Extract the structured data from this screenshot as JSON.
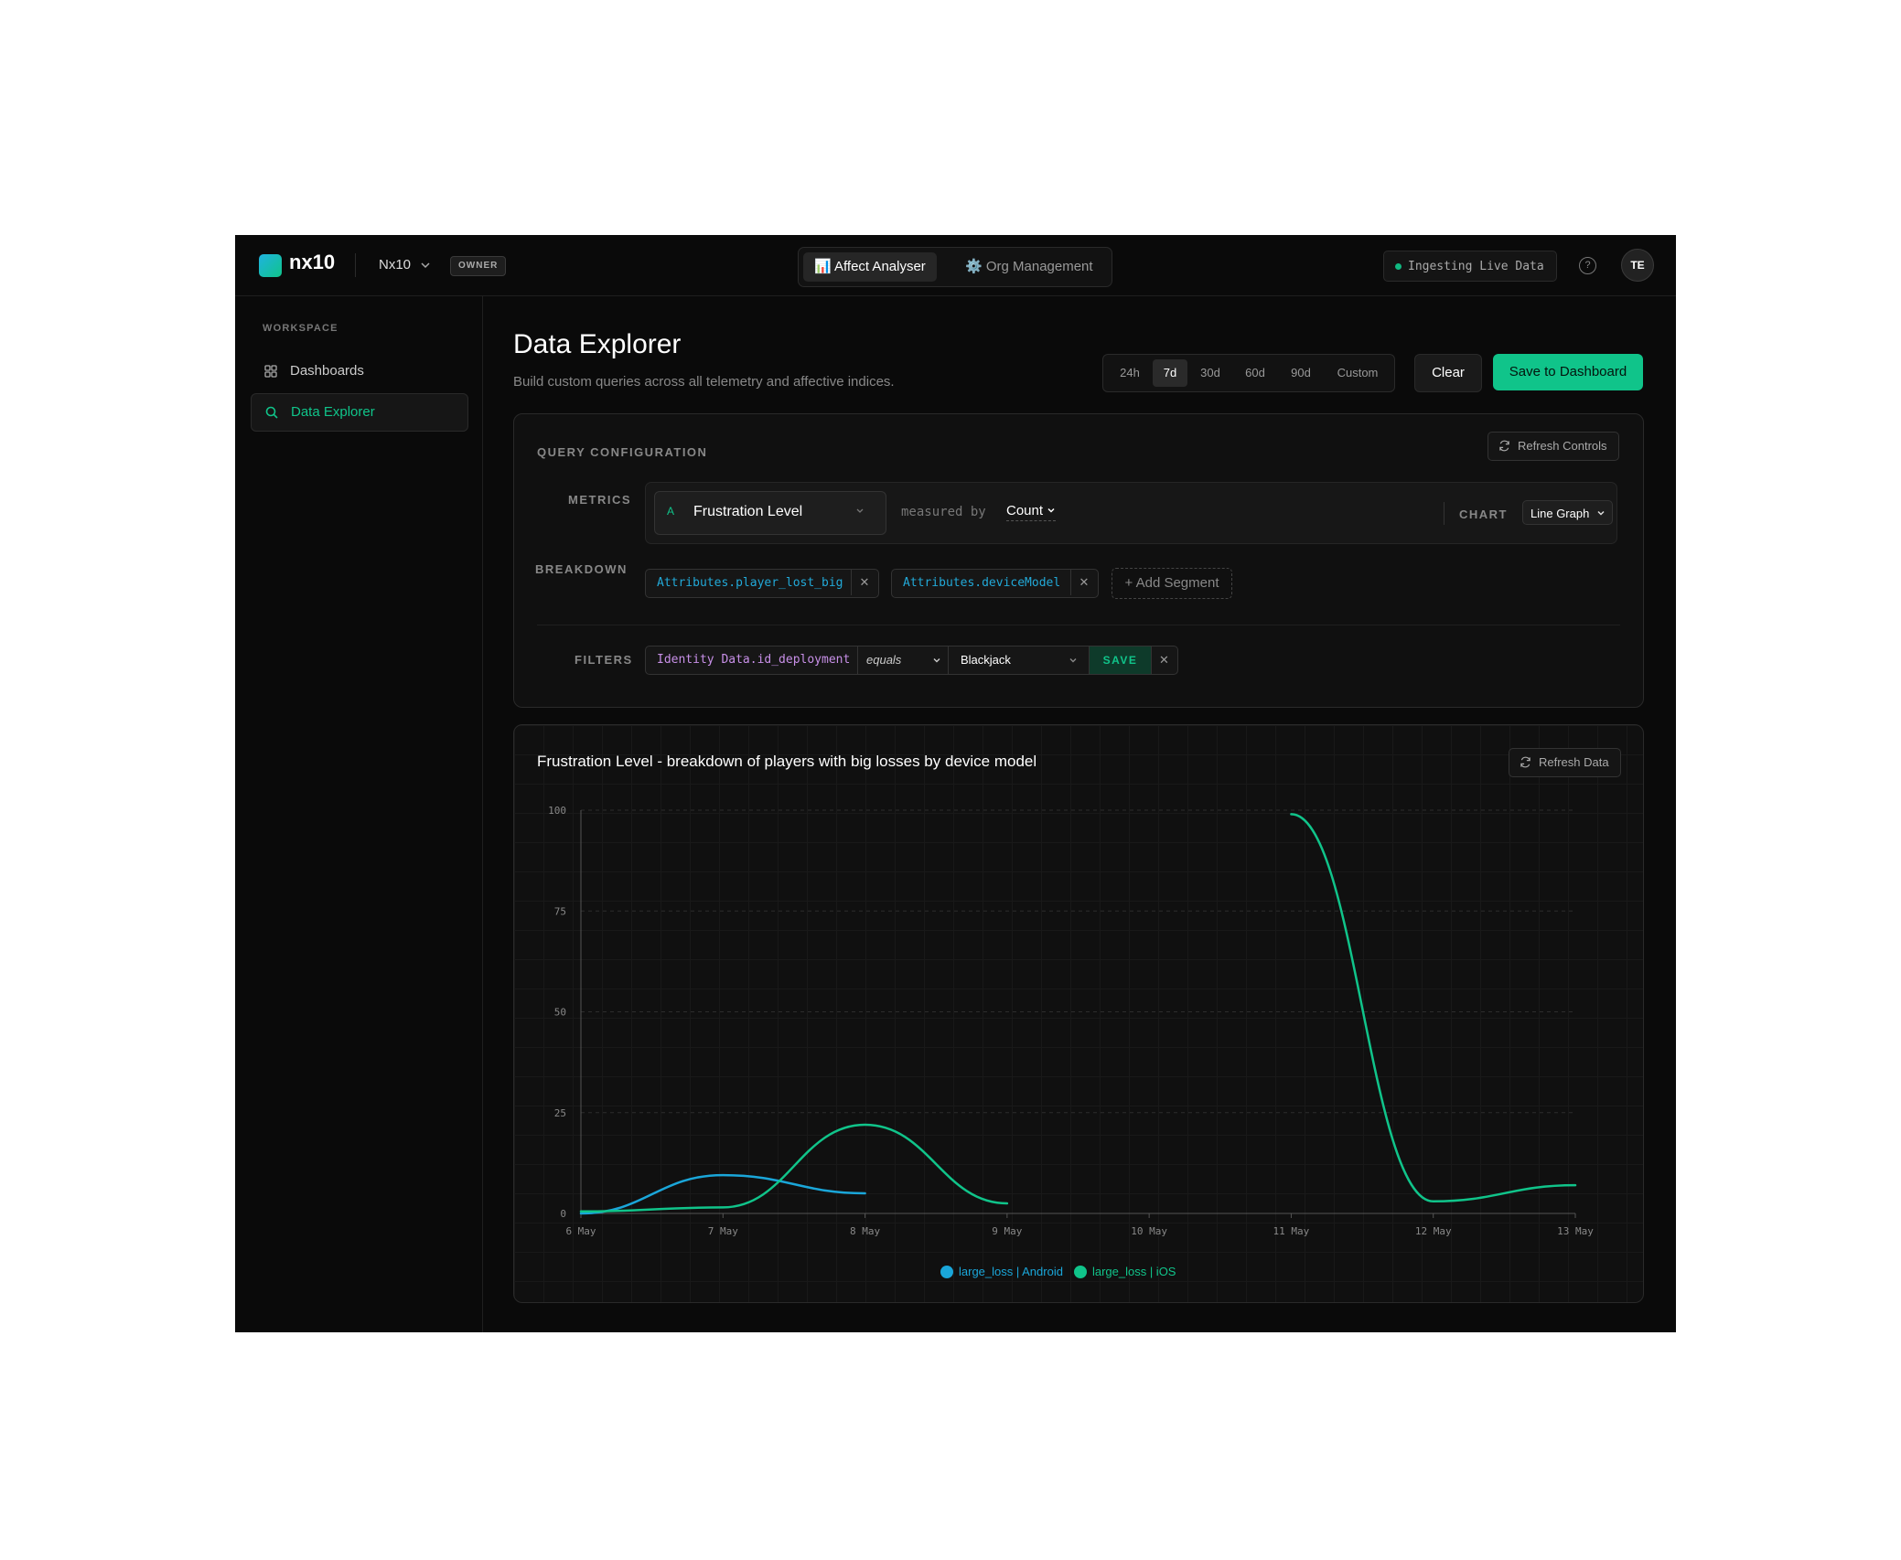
{
  "topbar": {
    "logo": "nx10",
    "org_name": "Nx10",
    "role_badge": "OWNER",
    "apps": [
      {
        "label": "📊 Affect Analyser",
        "active": true
      },
      {
        "label": "⚙️ Org Management",
        "active": false
      }
    ],
    "status": "Ingesting Live Data",
    "status_color": "#10b981",
    "help_icon": "help-circle-icon",
    "avatar": "TE"
  },
  "sidebar": {
    "section_label": "WORKSPACE",
    "items": [
      {
        "label": "Dashboards",
        "icon": "grid-icon",
        "active": false
      },
      {
        "label": "Data Explorer",
        "icon": "search-icon",
        "active": true
      }
    ]
  },
  "header": {
    "title": "Data Explorer",
    "subtitle": "Build custom queries across all telemetry and affective indices.",
    "ranges": [
      "24h",
      "7d",
      "30d",
      "60d",
      "90d",
      "Custom"
    ],
    "active_range": "7d",
    "clear_label": "Clear",
    "save_label": "Save to Dashboard"
  },
  "query": {
    "title": "QUERY CONFIGURATION",
    "refresh_label": "Refresh Controls",
    "metrics_label": "METRICS",
    "metric": {
      "letter": "A",
      "name": "Frustration Level"
    },
    "measured_by_label": "measured by",
    "measured_by": "Count",
    "chart_label": "CHART",
    "chart_type": "Line Graph",
    "breakdown_label": "BREAKDOWN",
    "breakdowns": [
      "Attributes.player_lost_big",
      "Attributes.deviceModel"
    ],
    "add_segment_label": "+ Add Segment",
    "filters_label": "FILTERS",
    "filter": {
      "field": "Identity Data.id_deployment",
      "operator": "equals",
      "value": "Blackjack",
      "save": "SAVE"
    }
  },
  "chart_panel": {
    "title": "Frustration Level - breakdown of players with big losses by device model",
    "refresh_label": "Refresh Data"
  },
  "chart_data": {
    "type": "line",
    "x": [
      "6 May",
      "7 May",
      "8 May",
      "9 May",
      "10 May",
      "11 May",
      "12 May",
      "13 May"
    ],
    "ylim": [
      0,
      100
    ],
    "yticks": [
      0,
      25,
      50,
      75,
      100
    ],
    "grid": true,
    "legend_position": "bottom",
    "series": [
      {
        "name": "large_loss | Android",
        "color": "#1aa6d9",
        "points": [
          [
            "6 May",
            0
          ],
          [
            "7 May",
            9.5
          ],
          [
            "8 May",
            5
          ]
        ]
      },
      {
        "name": "large_loss | iOS",
        "color": "#10c48a",
        "points": [
          [
            "6 May",
            0.5
          ],
          [
            "7 May",
            1.5
          ],
          [
            "8 May",
            22
          ],
          [
            "9 May",
            2.5
          ],
          [
            "11 May",
            99
          ],
          [
            "12 May",
            3
          ],
          [
            "13 May",
            7
          ]
        ]
      }
    ]
  }
}
